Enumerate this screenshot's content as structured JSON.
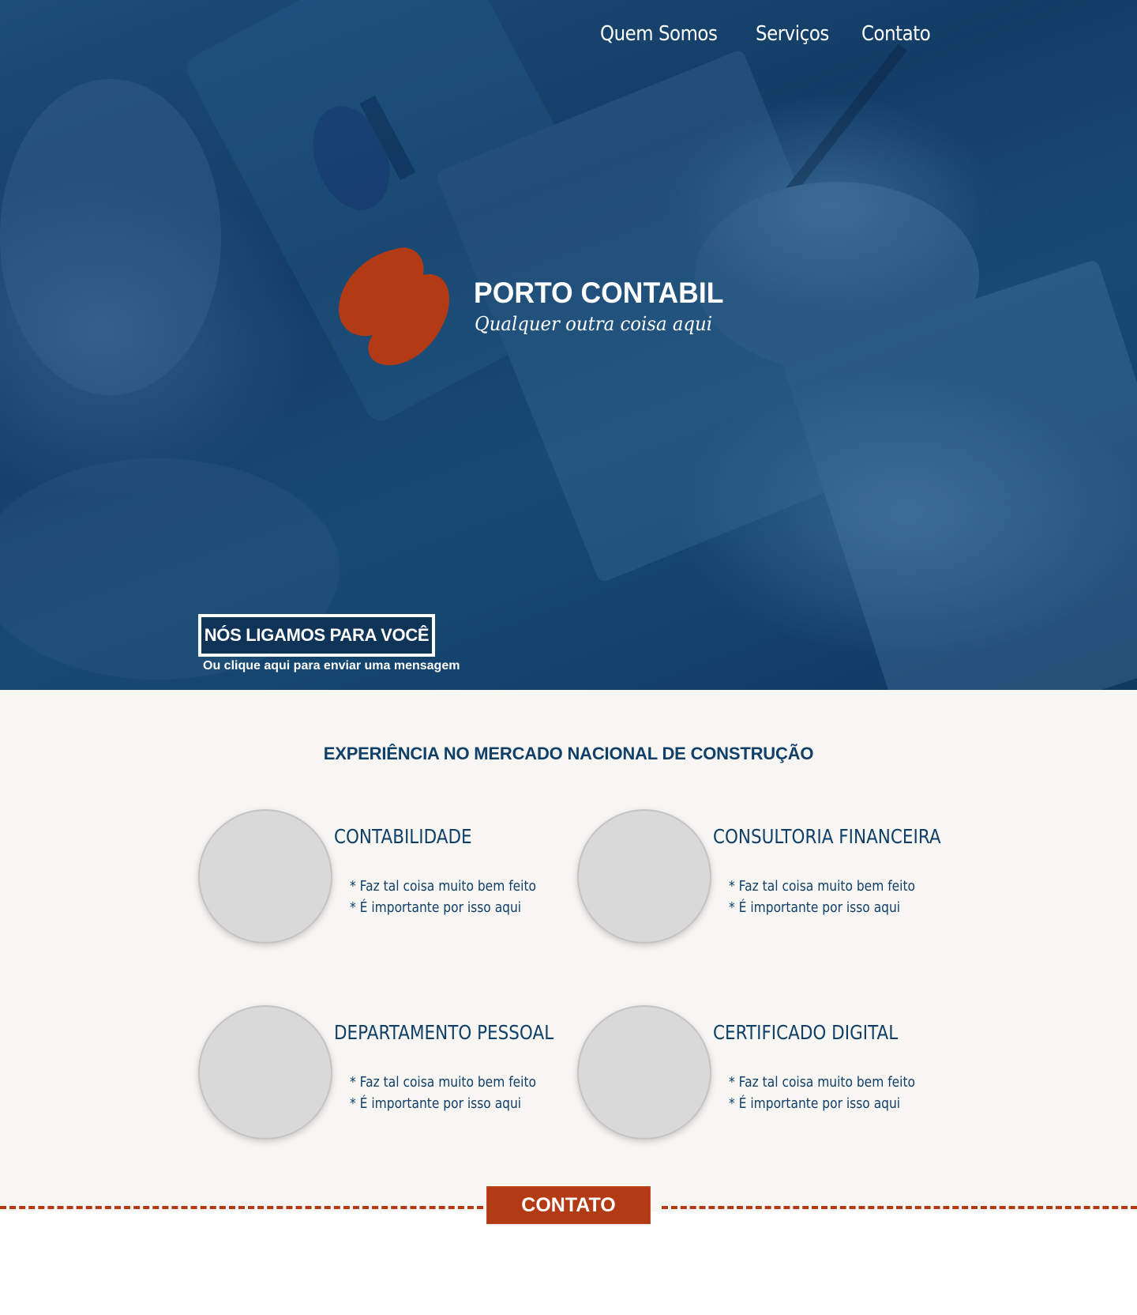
{
  "nav": {
    "items": [
      {
        "label": "Quem Somos"
      },
      {
        "label": "Serviços"
      },
      {
        "label": "Contato"
      }
    ]
  },
  "brand": {
    "name": "PORTO CONTABIL",
    "tagline": "Qualquer outra coisa aqui",
    "mark_color": "#b23a14"
  },
  "hero": {
    "cta_label": "NÓS LIGAMOS PARA VOCÊ",
    "cta_sub": "Ou clique aqui para enviar uma mensagem",
    "overlay_color": "#174a75"
  },
  "services": {
    "title": "EXPERIÊNCIA NO MERCADO NACIONAL DE CONSTRUÇÃO",
    "items": [
      {
        "title": "CONTABILIDADE",
        "bullets": [
          "* Faz tal coisa muito bem feito",
          "* É importante por isso aqui"
        ]
      },
      {
        "title": "CONSULTORIA FINANCEIRA",
        "bullets": [
          "* Faz tal coisa muito bem feito",
          "* É importante por isso aqui"
        ]
      },
      {
        "title": "DEPARTAMENTO PESSOAL",
        "bullets": [
          "* Faz tal coisa muito bem feito",
          "* É importante por isso aqui"
        ]
      },
      {
        "title": "CERTIFICADO DIGITAL",
        "bullets": [
          "* Faz tal coisa muito bem feito",
          "* É importante por isso aqui"
        ]
      }
    ],
    "text_color": "#103f67",
    "background": "#f8f6f3"
  },
  "contact": {
    "label": "CONTATO",
    "accent_color": "#b23a14"
  }
}
